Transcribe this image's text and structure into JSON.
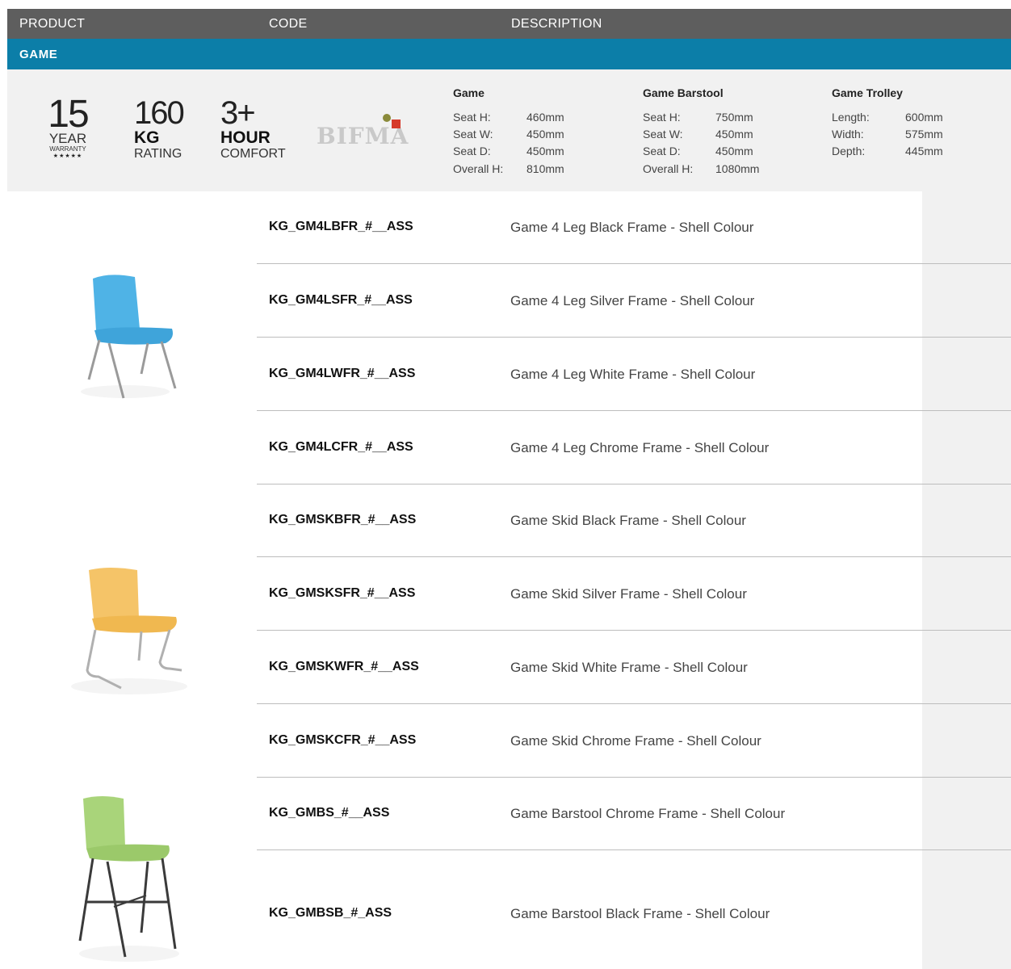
{
  "header": {
    "product": "PRODUCT",
    "code": "CODE",
    "description": "DESCRIPTION"
  },
  "section": {
    "title": "GAME"
  },
  "badges": {
    "warranty": {
      "number": "15",
      "line1": "YEAR",
      "line2": "WARRANTY",
      "stars": "★★★★★"
    },
    "rating": {
      "number": "160",
      "bold": "KG",
      "label": "RATING"
    },
    "comfort": {
      "number": "3+",
      "bold": "HOUR",
      "label": "COMFORT"
    },
    "bifma": "BIFMA"
  },
  "specs": [
    {
      "title": "Game",
      "rows": [
        {
          "label": "Seat H:",
          "value": "460mm"
        },
        {
          "label": "Seat W:",
          "value": "450mm"
        },
        {
          "label": "Seat D:",
          "value": "450mm"
        },
        {
          "label": "Overall H:",
          "value": "810mm"
        }
      ]
    },
    {
      "title": "Game Barstool",
      "rows": [
        {
          "label": "Seat H:",
          "value": "750mm"
        },
        {
          "label": "Seat W:",
          "value": "450mm"
        },
        {
          "label": "Seat D:",
          "value": "450mm"
        },
        {
          "label": "Overall H:",
          "value": "1080mm"
        }
      ]
    },
    {
      "title": "Game Trolley",
      "rows": [
        {
          "label": "Length:",
          "value": "600mm"
        },
        {
          "label": "Width:",
          "value": "575mm"
        },
        {
          "label": "Depth:",
          "value": "445mm"
        }
      ]
    }
  ],
  "products": [
    {
      "code": "KG_GM4LBFR_#__ASS",
      "description": "Game 4 Leg Black Frame - Shell Colour"
    },
    {
      "code": "KG_GM4LSFR_#__ASS",
      "description": "Game 4 Leg Silver Frame - Shell Colour"
    },
    {
      "code": "KG_GM4LWFR_#__ASS",
      "description": "Game 4 Leg White Frame - Shell Colour"
    },
    {
      "code": "KG_GM4LCFR_#__ASS",
      "description": "Game 4 Leg Chrome Frame - Shell Colour"
    },
    {
      "code": "KG_GMSKBFR_#__ASS",
      "description": "Game Skid Black Frame - Shell Colour"
    },
    {
      "code": "KG_GMSKSFR_#__ASS",
      "description": "Game Skid Silver Frame - Shell Colour"
    },
    {
      "code": "KG_GMSKWFR_#__ASS",
      "description": "Game Skid White Frame - Shell Colour"
    },
    {
      "code": "KG_GMSKCFR_#__ASS",
      "description": "Game Skid Chrome Frame - Shell Colour"
    },
    {
      "code": "KG_GMBS_#__ASS",
      "description": "Game Barstool Chrome Frame - Shell Colour"
    },
    {
      "code": "KG_GMBSB_#_ASS",
      "description": "Game Barstool Black Frame - Shell Colour"
    }
  ],
  "colors": {
    "header": "#5e5e5e",
    "section": "#0c7ea8",
    "band": "#f1f1f1",
    "chair_blue": "#4fb3e6",
    "chair_orange": "#f5c468",
    "chair_green": "#a9d47a"
  }
}
